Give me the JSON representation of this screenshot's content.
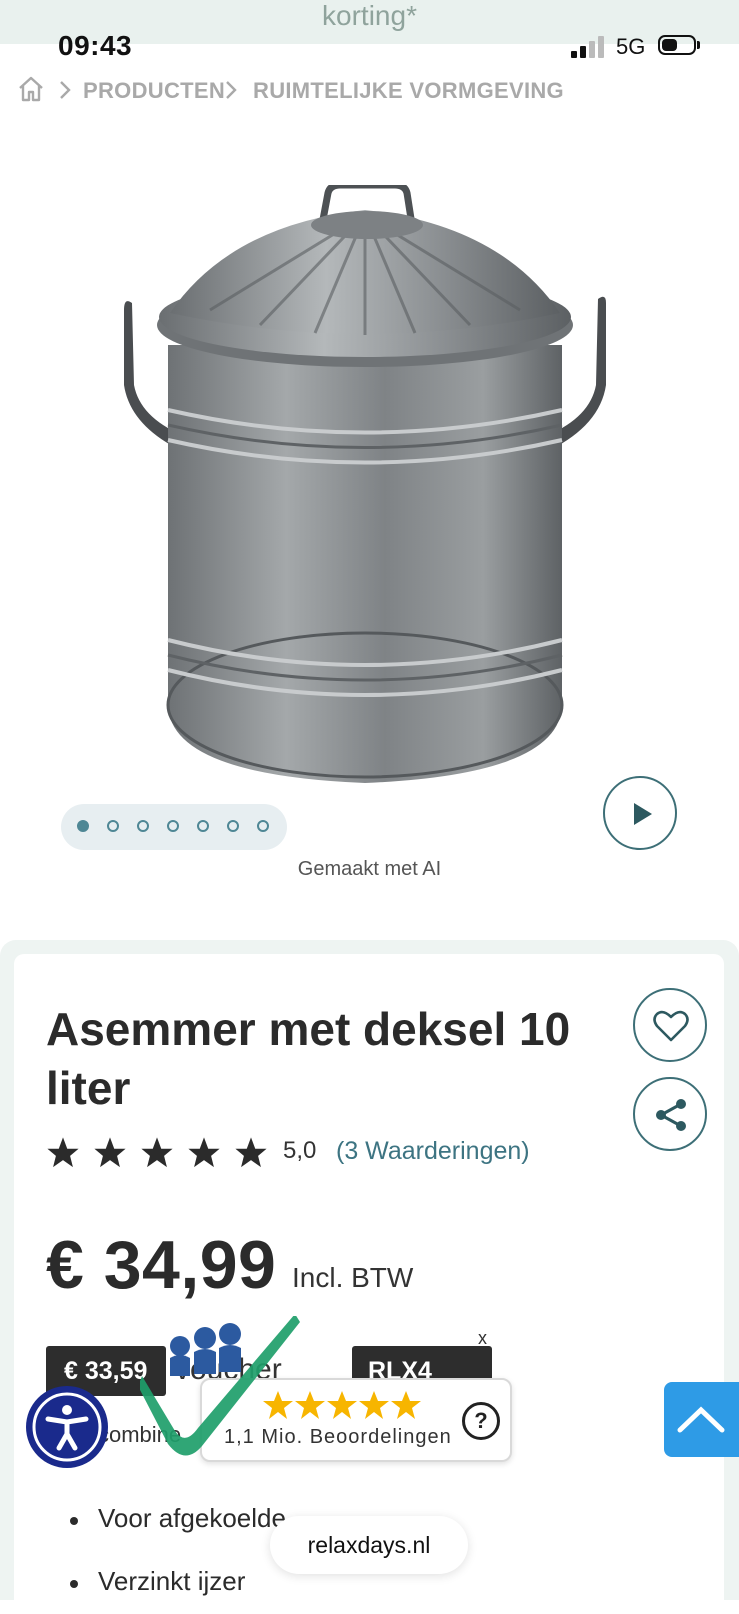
{
  "promo": {
    "text": "korting*"
  },
  "status_bar": {
    "time": "09:43",
    "network": "5G"
  },
  "breadcrumb": {
    "items": [
      "PRODUCTEN",
      "RUIMTELIJKE VORMGEVING"
    ]
  },
  "gallery": {
    "image_icon": "galvanized-waste-bin-image",
    "dot_count": 7,
    "active_dot": 0,
    "caption": "Gemaakt met AI",
    "play_icon": "play-icon"
  },
  "product": {
    "title": "Asemmer met deksel 10 liter",
    "rating_value": "5,0",
    "rating_count": "(3 Waarderingen)",
    "stars": 5,
    "price": "€ 34,99",
    "price_note": "Incl. BTW",
    "voucher_price": "€ 33,59",
    "voucher_text": "voucher",
    "voucher_code": "RLX4",
    "combine_text": "combine",
    "features": [
      "Voor afgekoelde",
      "Verzinkt ijzer"
    ]
  },
  "review_widget": {
    "stars": 5,
    "text": "1,1 Mio. Beoordelingen",
    "help": "?"
  },
  "url": {
    "domain": "relaxdays.nl"
  },
  "colors": {
    "accent": "#3d7482",
    "star": "#2b2b2b",
    "review_star": "#f7b500",
    "a11y": "#1a2a8c",
    "scroll_top": "#2e9be6"
  }
}
